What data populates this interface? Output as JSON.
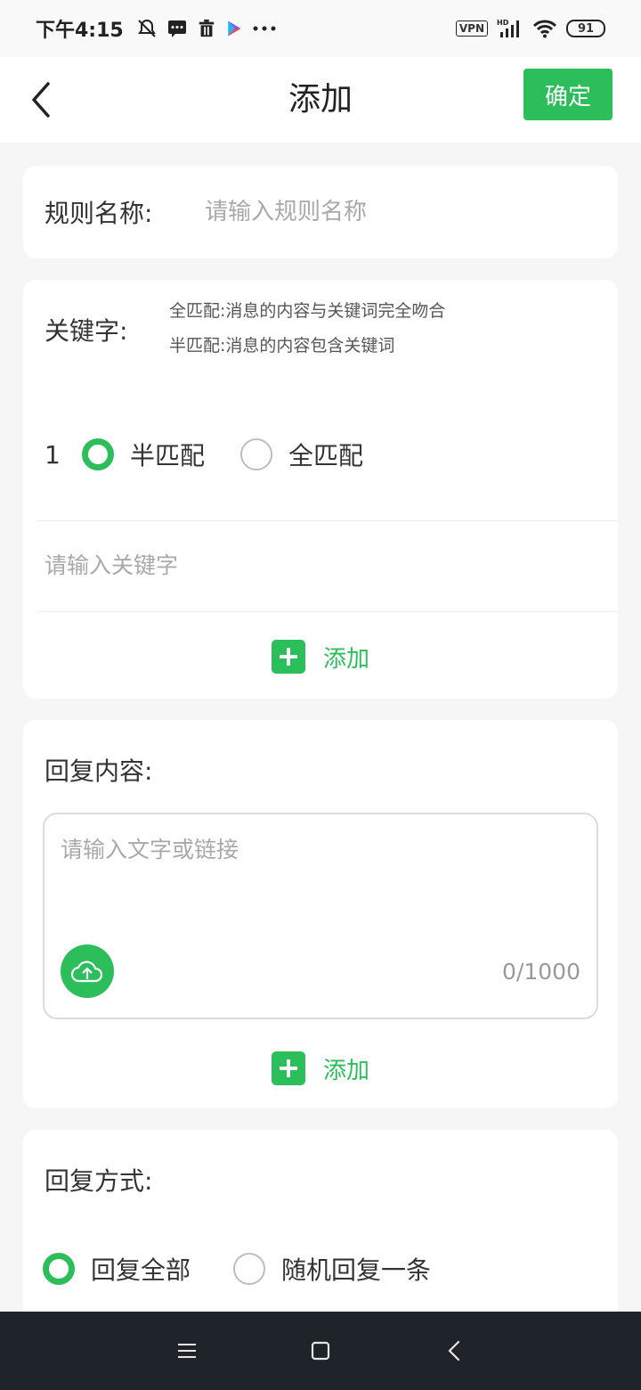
{
  "status_bar": {
    "time": "下午4:15",
    "left_icons": [
      "bell-off-icon",
      "message-icon",
      "trash-icon",
      "play-store-icon",
      "more-dots-icon"
    ],
    "vpn": "VPN",
    "network": "HD",
    "battery": "91"
  },
  "header": {
    "title": "添加",
    "confirm_label": "确定"
  },
  "rule": {
    "label": "规则名称:",
    "placeholder": "请输入规则名称"
  },
  "keyword": {
    "label": "关键字:",
    "desc_full": "全匹配:消息的内容与关键词完全吻合",
    "desc_half": "半匹配:消息的内容包含关键词",
    "items": [
      {
        "index": "1",
        "options": [
          "半匹配",
          "全匹配"
        ],
        "selected": "半匹配",
        "placeholder": "请输入关键字"
      }
    ],
    "add_label": "添加"
  },
  "reply": {
    "label": "回复内容:",
    "placeholder": "请输入文字或链接",
    "char_count": "0/1000",
    "add_label": "添加"
  },
  "reply_mode": {
    "label": "回复方式:",
    "options": [
      "回复全部",
      "随机回复一条"
    ],
    "selected": "回复全部"
  },
  "colors": {
    "accent": "#2bbe5a",
    "nav_bg": "#1f242b",
    "page_bg": "#f6f6f6"
  }
}
